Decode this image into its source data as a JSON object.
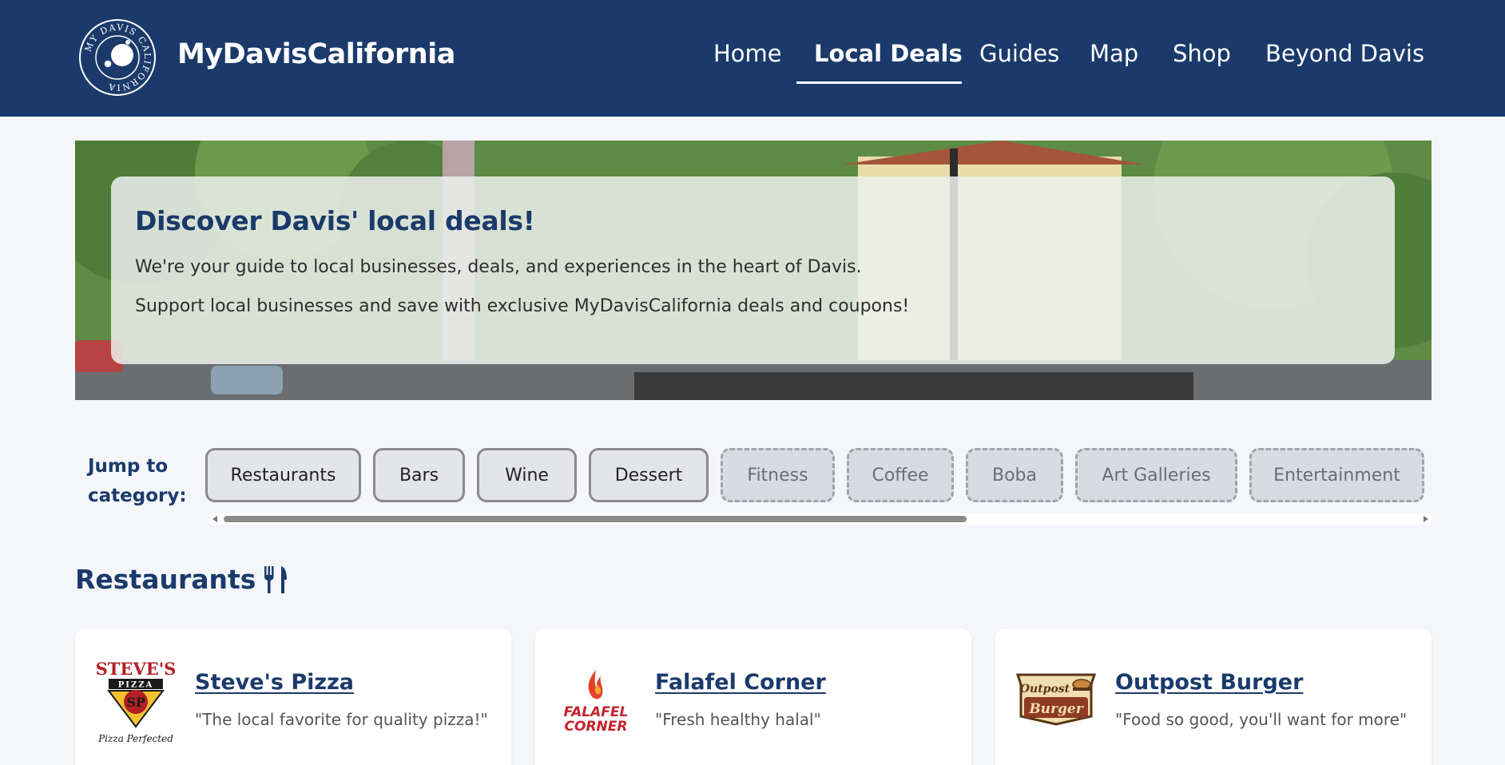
{
  "brand": {
    "name": "MyDavisCalifornia",
    "logo_text": "MY DAVIS CALIFORNIA"
  },
  "nav": {
    "items": [
      {
        "label": "Home"
      },
      {
        "label": "Local Deals",
        "active": true
      },
      {
        "label": "Guides"
      },
      {
        "label": "Map"
      },
      {
        "label": "Shop"
      },
      {
        "label": "Beyond Davis"
      }
    ]
  },
  "hero": {
    "title": "Discover Davis' local deals!",
    "line1": "We're your guide to local businesses, deals, and experiences in the heart of Davis.",
    "line2": "Support local businesses and save with exclusive MyDavisCalifornia deals and coupons!"
  },
  "categories": {
    "label": "Jump to category:",
    "items": [
      {
        "label": "Restaurants",
        "available": true
      },
      {
        "label": "Bars",
        "available": true
      },
      {
        "label": "Wine",
        "available": true
      },
      {
        "label": "Dessert",
        "available": true
      },
      {
        "label": "Fitness",
        "available": false
      },
      {
        "label": "Coffee",
        "available": false
      },
      {
        "label": "Boba",
        "available": false
      },
      {
        "label": "Art Galleries",
        "available": false
      },
      {
        "label": "Entertainment",
        "available": false
      }
    ]
  },
  "section": {
    "title": "Restaurants",
    "icon": "utensils-icon"
  },
  "cards": [
    {
      "name": "Steve's Pizza",
      "tagline": "\"The local favorite for quality pizza!\"",
      "logo": {
        "top": "STEVE'S",
        "mid": "PIZZA",
        "mono": "SP",
        "script": "Pizza Perfected"
      }
    },
    {
      "name": "Falafel Corner",
      "tagline": "\"Fresh healthy halal\"",
      "logo": {
        "line1": "FALAFEL",
        "line2": "CORNER"
      }
    },
    {
      "name": "Outpost Burger",
      "tagline": "\"Food so good, you'll want for more\"",
      "logo": {
        "line1": "Outpost",
        "line2": "Burger"
      }
    }
  ],
  "colors": {
    "primary": "#1b3a6b",
    "background": "#f4f6fa",
    "chip": "#e3e5e9",
    "chip_disabled": "#d8dbe1"
  }
}
